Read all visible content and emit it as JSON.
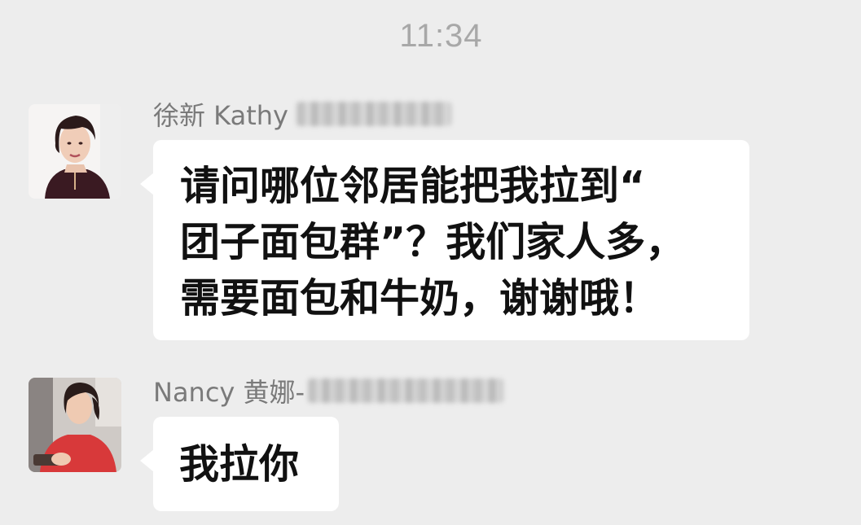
{
  "chat": {
    "timestamp": "11:34",
    "messages": [
      {
        "sender": "徐新 Kathy",
        "text": "请问哪位邻居能把我拉到“\n团子面包群”？我们家人多，\n需要面包和牛奶，谢谢哦！"
      },
      {
        "sender": "Nancy 黄娜-",
        "text": "我拉你"
      }
    ]
  }
}
